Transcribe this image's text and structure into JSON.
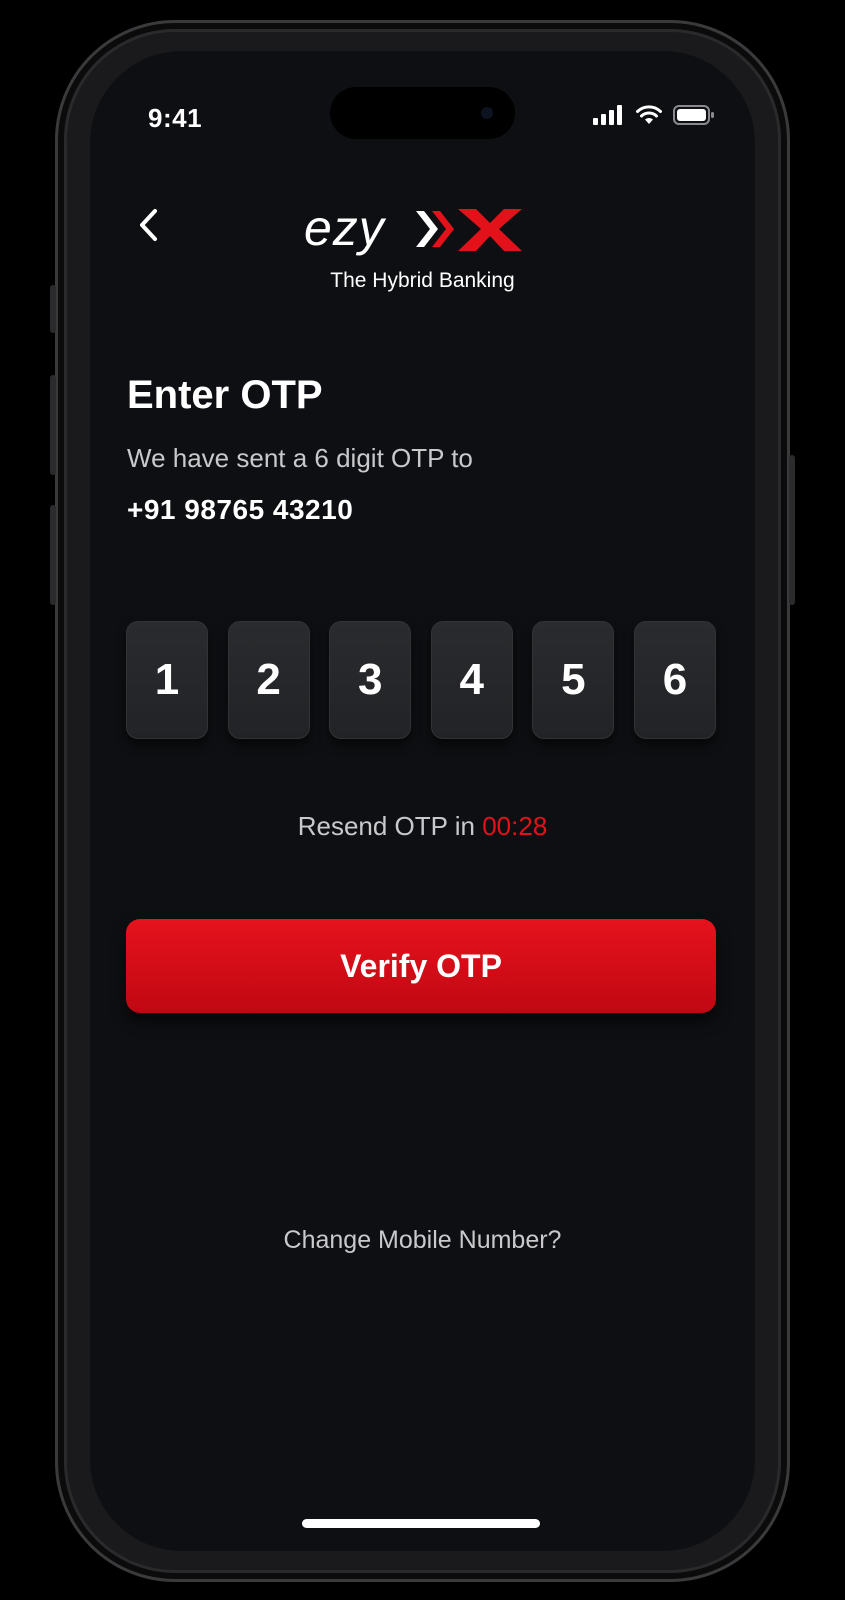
{
  "status_bar": {
    "time": "9:41",
    "icons": [
      "signal-icon",
      "wifi-icon",
      "battery-icon"
    ]
  },
  "header": {
    "back_icon": "chevron-left-icon",
    "logo_text": "ezy X",
    "tagline": "The Hybrid Banking"
  },
  "main": {
    "title": "Enter OTP",
    "subtitle": "We have sent a 6 digit OTP to",
    "phone_number": "+91 98765 43210",
    "otp_digits": [
      "1",
      "2",
      "3",
      "4",
      "5",
      "6"
    ],
    "resend_prefix": "Resend OTP in ",
    "resend_timer": "00:28",
    "verify_label": "Verify OTP",
    "change_number_label": "Change Mobile Number?"
  },
  "colors": {
    "background": "#0e0f12",
    "accent": "#e3111a",
    "button": "#d20d17",
    "text_primary": "#ffffff",
    "text_secondary": "#c9c9cc",
    "otp_box": "#26272a"
  }
}
